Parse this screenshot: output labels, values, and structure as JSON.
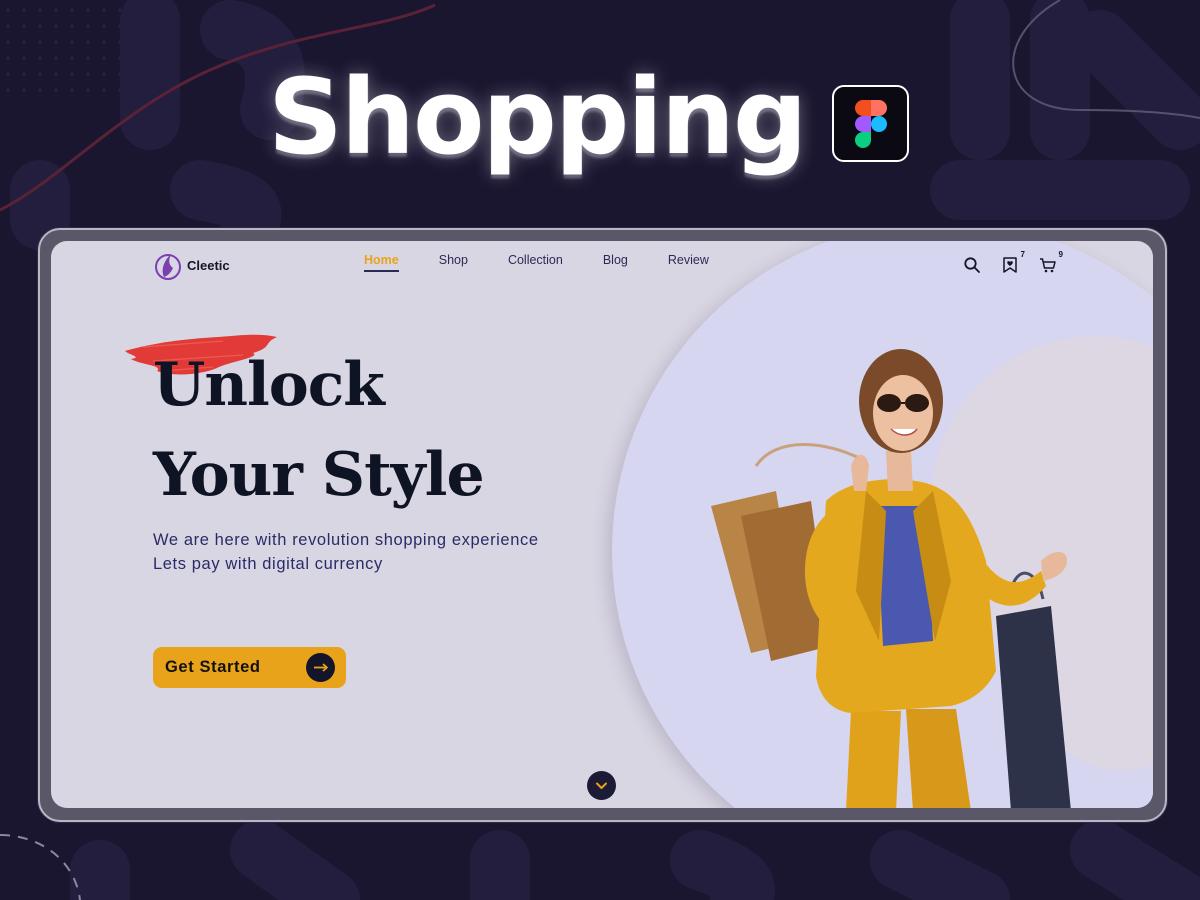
{
  "headline": "Shopping",
  "figma_badge_icon": "figma-icon",
  "nav": {
    "brand": "Cleetic",
    "links": [
      "Home",
      "Shop",
      "Collection",
      "Blog",
      "Review"
    ],
    "active_link": "Home",
    "icons": [
      {
        "name": "search-icon",
        "count": ""
      },
      {
        "name": "wishlist-icon",
        "count": "7"
      },
      {
        "name": "cart-icon",
        "count": "9"
      }
    ]
  },
  "hero": {
    "title_line_1": "Unlock",
    "title_line_2": "Your Style",
    "subtitle_line_1": "We are here with revolution shopping experience",
    "subtitle_line_2": "Lets pay with digital currency",
    "cta_label": "Get Started"
  },
  "colors": {
    "accent": "#e8a31a",
    "background": "#1a1630",
    "screen": "#d9d6e3",
    "brush": "#e23a36",
    "text_dark": "#0f1424",
    "text_navy": "#2a2b66"
  }
}
